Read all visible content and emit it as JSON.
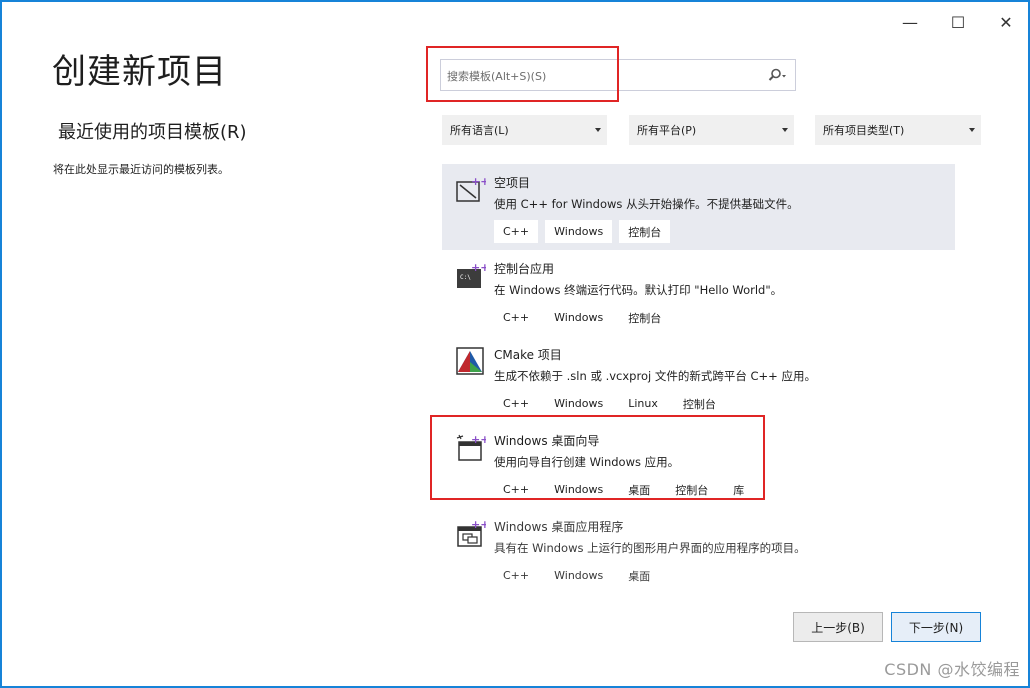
{
  "window": {
    "title": "创建新项目",
    "controls": {
      "minimize": "—",
      "maximize": "☐",
      "close": "✕"
    }
  },
  "recent": {
    "heading": "最近使用的项目模板(R)",
    "empty_text": "将在此处显示最近访问的模板列表。"
  },
  "search": {
    "placeholder": "搜索模板(Alt+S)(S)",
    "icon": "search-icon"
  },
  "filters": {
    "language": "所有语言(L)",
    "platform": "所有平台(P)",
    "project_type": "所有项目类型(T)"
  },
  "templates": [
    {
      "name": "空项目",
      "description": "使用 C++ for Windows 从头开始操作。不提供基础文件。",
      "tags": [
        "C++",
        "Windows",
        "控制台"
      ],
      "icon": "empty-project-icon",
      "selected": true
    },
    {
      "name": "控制台应用",
      "description": "在 Windows 终端运行代码。默认打印 \"Hello World\"。",
      "tags": [
        "C++",
        "Windows",
        "控制台"
      ],
      "icon": "console-app-icon",
      "selected": false
    },
    {
      "name": "CMake 项目",
      "description": "生成不依赖于 .sln 或 .vcxproj 文件的新式跨平台 C++ 应用。",
      "tags": [
        "C++",
        "Windows",
        "Linux",
        "控制台"
      ],
      "icon": "cmake-icon",
      "selected": false
    },
    {
      "name": "Windows 桌面向导",
      "description": "使用向导自行创建 Windows 应用。",
      "tags": [
        "C++",
        "Windows",
        "桌面",
        "控制台",
        "库"
      ],
      "icon": "desktop-wizard-icon",
      "selected": false
    },
    {
      "name": "Windows 桌面应用程序",
      "description": "具有在 Windows 上运行的图形用户界面的应用程序的项目。",
      "tags": [
        "C++",
        "Windows",
        "桌面"
      ],
      "icon": "desktop-app-icon",
      "selected": false
    }
  ],
  "buttons": {
    "back": "上一步(B)",
    "next": "下一步(N)"
  },
  "watermark": "CSDN @水饺编程",
  "colors": {
    "accent": "#1683d8",
    "highlight_red": "#e02525",
    "selected_bg": "#e8eaf0",
    "vs_purple": "#8a4fc8"
  }
}
